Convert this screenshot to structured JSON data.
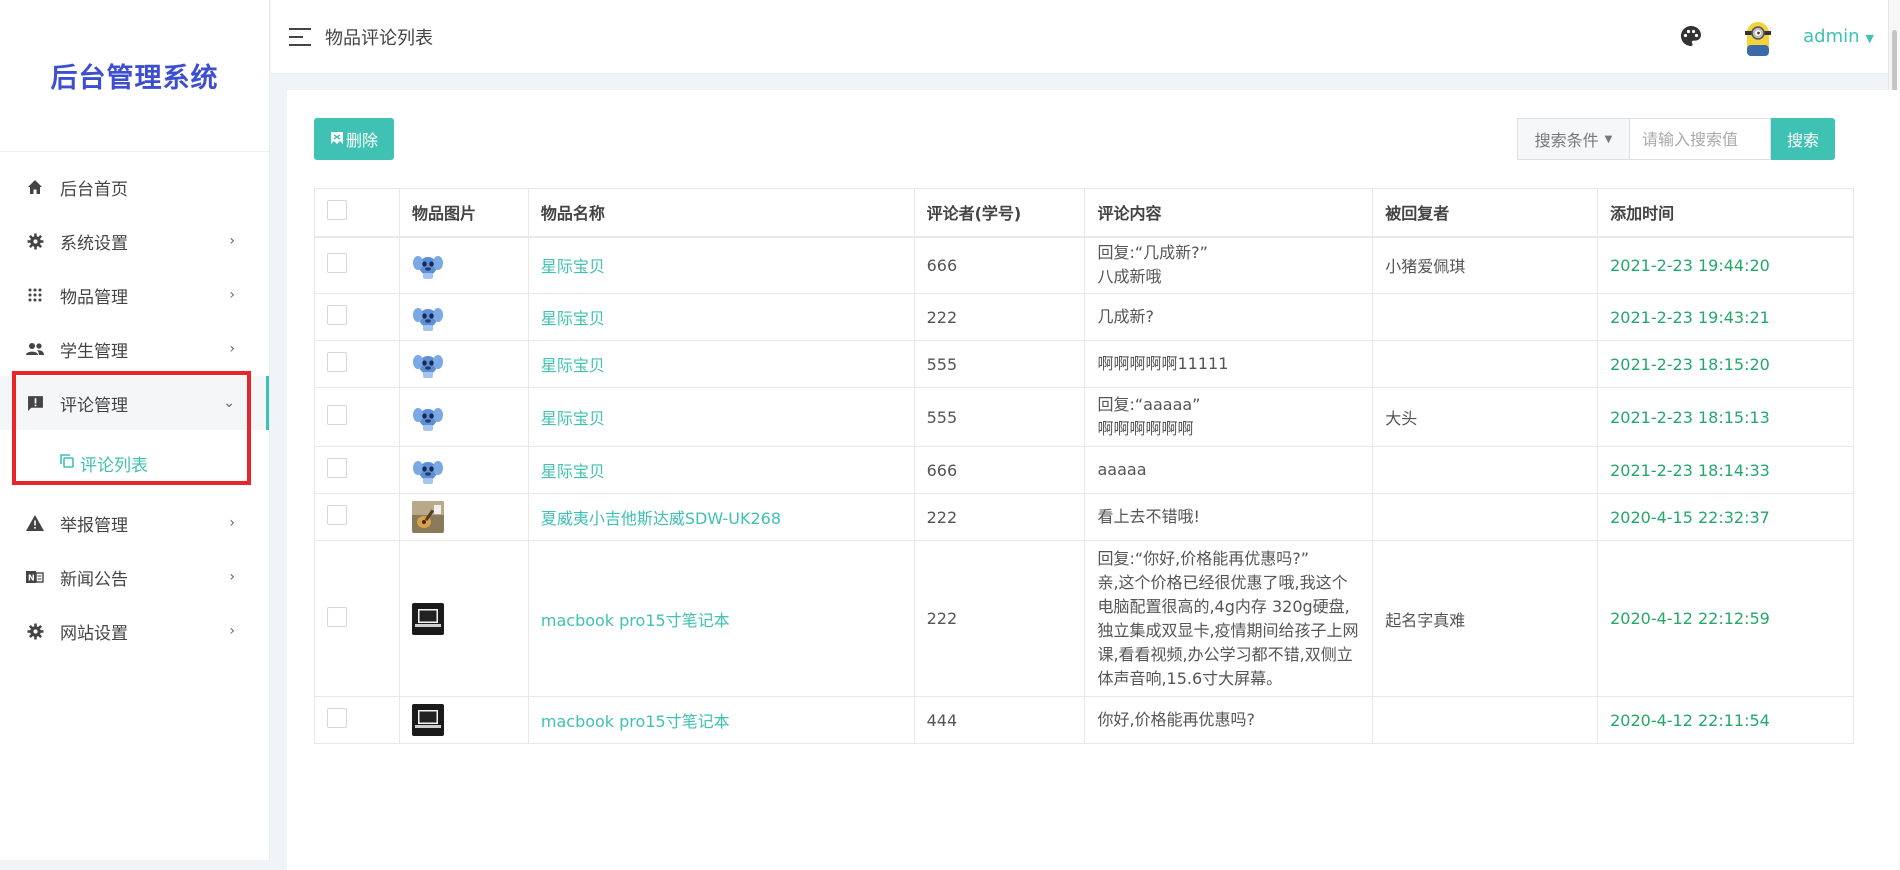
{
  "sidebar": {
    "brand": "后台管理系统",
    "items": [
      {
        "label": "后台首页",
        "icon": "home-icon",
        "chevron": ""
      },
      {
        "label": "系统设置",
        "icon": "gear-icon",
        "chevron": "›"
      },
      {
        "label": "物品管理",
        "icon": "grid-icon",
        "chevron": "›"
      },
      {
        "label": "学生管理",
        "icon": "people-icon",
        "chevron": "›"
      },
      {
        "label": "评论管理",
        "icon": "comment-icon",
        "chevron": "⌄"
      },
      {
        "label": "举报管理",
        "icon": "warning-icon",
        "chevron": "›"
      },
      {
        "label": "新闻公告",
        "icon": "news-icon",
        "chevron": "›"
      },
      {
        "label": "网站设置",
        "icon": "gear-icon",
        "chevron": "›"
      }
    ],
    "subitem": {
      "label": "评论列表",
      "icon": "copy-icon"
    }
  },
  "topbar": {
    "title": "物品评论列表",
    "user": "admin"
  },
  "toolbar": {
    "delete_label": "删除",
    "search_condition": "搜索条件",
    "search_placeholder": "请输入搜索值",
    "search_label": "搜索"
  },
  "table": {
    "headers": [
      "物品图片",
      "物品名称",
      "评论者(学号)",
      "评论内容",
      "被回复者",
      "添加时间"
    ],
    "rows": [
      {
        "image": "stitch",
        "name": "星际宝贝",
        "commenter": "666",
        "content": "回复:“几成新?”\n八成新哦",
        "reply_to": "小猪爱佩琪",
        "time": "2021-2-23 19:44:20"
      },
      {
        "image": "stitch",
        "name": "星际宝贝",
        "commenter": "222",
        "content": "几成新?",
        "reply_to": "",
        "time": "2021-2-23 19:43:21"
      },
      {
        "image": "stitch",
        "name": "星际宝贝",
        "commenter": "555",
        "content": "啊啊啊啊啊11111",
        "reply_to": "",
        "time": "2021-2-23 18:15:20"
      },
      {
        "image": "stitch",
        "name": "星际宝贝",
        "commenter": "555",
        "content": "回复:“aaaaa”\n啊啊啊啊啊啊",
        "reply_to": "大头",
        "time": "2021-2-23 18:15:13"
      },
      {
        "image": "stitch",
        "name": "星际宝贝",
        "commenter": "666",
        "content": "aaaaa",
        "reply_to": "",
        "time": "2021-2-23 18:14:33"
      },
      {
        "image": "guitar",
        "name": "夏威夷小吉他斯达威SDW-UK268",
        "commenter": "222",
        "content": "看上去不错哦!",
        "reply_to": "",
        "time": "2020-4-15 22:32:37"
      },
      {
        "image": "laptop",
        "name": "macbook pro15寸笔记本",
        "commenter": "222",
        "content": "回复:“你好,价格能再优惠吗?”\n亲,这个价格已经很优惠了哦,我这个电脑配置很高的,4g内存 320g硬盘,独立集成双显卡,疫情期间给孩子上网课,看看视频,办公学习都不错,双侧立体声音响,15.6寸大屏幕。",
        "reply_to": "起名字真难",
        "time": "2020-4-12 22:12:59"
      },
      {
        "image": "laptop",
        "name": "macbook pro15寸笔记本",
        "commenter": "444",
        "content": "你好,价格能再优惠吗?",
        "reply_to": "",
        "time": "2020-4-12 22:11:54"
      }
    ]
  },
  "colors": {
    "accent": "#3fc1b3",
    "brand": "#3d4fd0",
    "date": "#23a86a",
    "highlight": "#e8262a"
  }
}
